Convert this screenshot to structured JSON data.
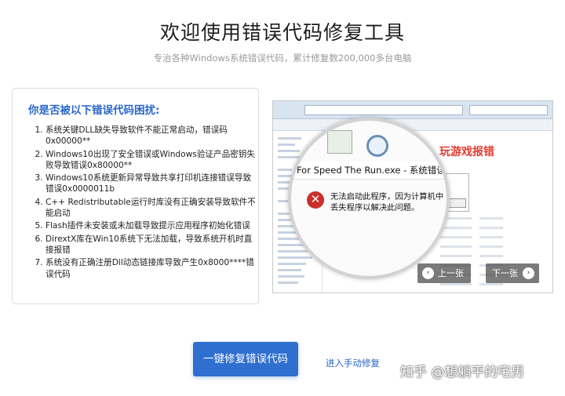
{
  "header": {
    "title": "欢迎使用错误代码修复工具",
    "subtitle": "专治各种Windows系统错误代码，累计修复数200,000多台电脑"
  },
  "problems": {
    "heading": "你是否被以下错误代码困扰:",
    "items": [
      "系统关键DLL缺失导致软件不能正常启动，错误码0x00000**",
      "Windows10出现了安全错误或Windows验证产品密钥失败导致错误0x80000**",
      "Windows10系统更新异常导致共享打印机连接错误导致错误0x0000011b",
      "C++ Redistributable运行时库没有正确安装导致软件不能启动",
      "Flash插件未安装或未加载导致提示应用程序初始化错误",
      "DirextX库在Win10系统下无法加载，导致系统开机时直接报错",
      "系统没有正确注册Dll动态链接库导致产生0x8000****错误代码"
    ]
  },
  "screenshot": {
    "game_label": "玩游戏报错",
    "dialog_title": "d For Speed The Run.exe - 系统错误",
    "error_message": "无法启动此程序，因为计算机中丢失程序以解决此问题。",
    "prev_label": "上一张",
    "next_label": "下一张"
  },
  "actions": {
    "fix_button": "一键修复错误代码",
    "manual_link": "进入手动修复"
  },
  "watermark": "知乎 @想躺平的宅男",
  "icons": {
    "error": "error-x-icon",
    "prev": "chevron-left-icon",
    "next": "chevron-right-icon"
  },
  "colors": {
    "accent": "#2f6fcf",
    "heading_blue": "#2a66c9",
    "game_label": "#e23b2f",
    "error": "#c9302c"
  }
}
